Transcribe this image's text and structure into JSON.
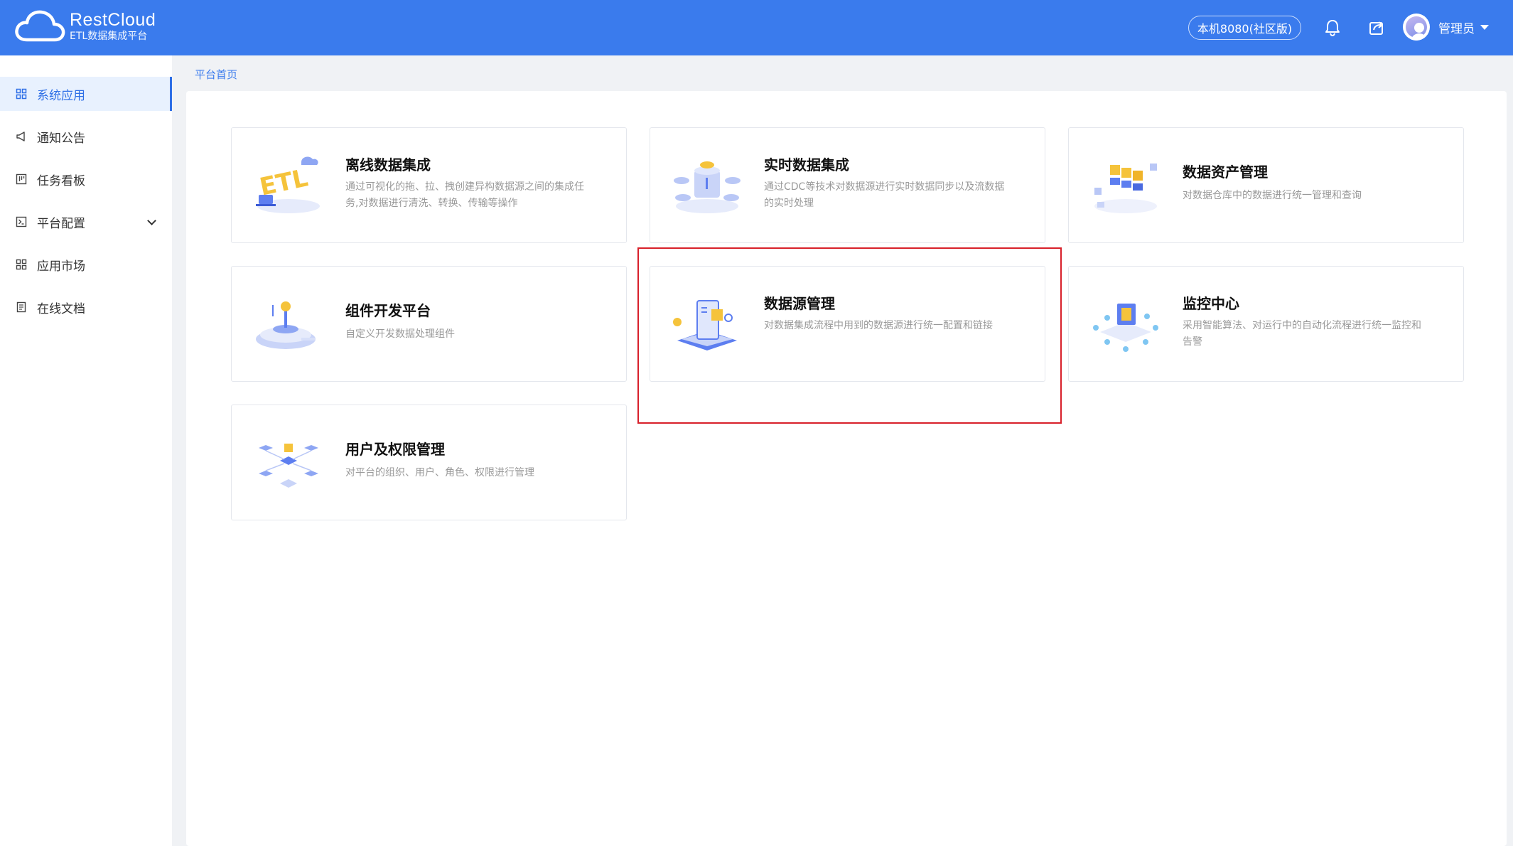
{
  "header": {
    "logo_title": "RestCloud",
    "logo_subtitle": "ETL数据集成平台",
    "server_label": "本机8080(社区版)",
    "user_name": "管理员",
    "icons": [
      "bell-icon",
      "share-icon",
      "avatar",
      "caret-down-icon"
    ]
  },
  "sidebar": {
    "items": [
      {
        "label": "系统应用",
        "icon": "grid-icon",
        "active": true
      },
      {
        "label": "通知公告",
        "icon": "megaphone-icon",
        "active": false
      },
      {
        "label": "任务看板",
        "icon": "kanban-icon",
        "active": false
      },
      {
        "label": "平台配置",
        "icon": "terminal-icon",
        "active": false,
        "expandable": true
      },
      {
        "label": "应用市场",
        "icon": "grid-icon",
        "active": false
      },
      {
        "label": "在线文档",
        "icon": "document-icon",
        "active": false
      }
    ]
  },
  "breadcrumb": "平台首页",
  "cards": [
    {
      "title": "离线数据集成",
      "desc": "通过可视化的拖、拉、拽创建异构数据源之间的集成任务,对数据进行清洗、转换、传输等操作"
    },
    {
      "title": "实时数据集成",
      "desc": "通过CDC等技术对数据源进行实时数据同步以及流数据的实时处理"
    },
    {
      "title": "数据资产管理",
      "desc": "对数据仓库中的数据进行统一管理和查询"
    },
    {
      "title": "组件开发平台",
      "desc": "自定义开发数据处理组件"
    },
    {
      "title": "数据源管理",
      "desc": "对数据集成流程中用到的数据源进行统一配置和链接"
    },
    {
      "title": "监控中心",
      "desc": "采用智能算法、对运行中的自动化流程进行统一监控和告警"
    },
    {
      "title": "用户及权限管理",
      "desc": "对平台的组织、用户、角色、权限进行管理"
    }
  ],
  "colors": {
    "header_bg": "#3a7bed",
    "accent": "#2e6fe6",
    "highlight": "#d8202a"
  }
}
